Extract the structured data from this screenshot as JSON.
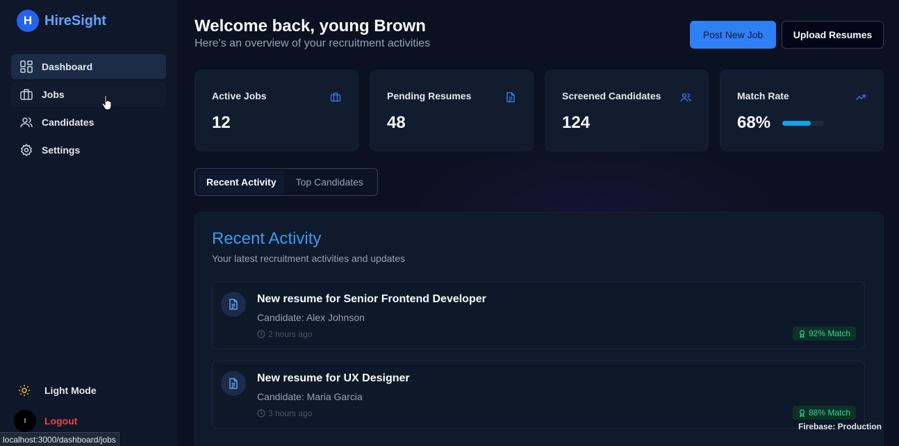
{
  "brand": {
    "logo_letter": "H",
    "name": "HireSight"
  },
  "sidebar": {
    "items": [
      {
        "label": "Dashboard",
        "icon": "dashboard-icon",
        "active": true
      },
      {
        "label": "Jobs",
        "icon": "briefcase-icon",
        "active": false
      },
      {
        "label": "Candidates",
        "icon": "users-icon",
        "active": false
      },
      {
        "label": "Settings",
        "icon": "gear-icon",
        "active": false
      }
    ],
    "light_mode_label": "Light Mode",
    "avatar_letter": "I",
    "logout_label": "Logout"
  },
  "status_bar_url": "localhost:3000/dashboard/jobs",
  "header": {
    "title": "Welcome back, young Brown",
    "subtitle": "Here's an overview of your recruitment activities",
    "post_job_label": "Post New Job",
    "upload_label": "Upload Resumes"
  },
  "stats": [
    {
      "title": "Active Jobs",
      "value": "12",
      "icon": "briefcase-icon"
    },
    {
      "title": "Pending Resumes",
      "value": "48",
      "icon": "document-icon"
    },
    {
      "title": "Screened Candidates",
      "value": "124",
      "icon": "users-icon"
    },
    {
      "title": "Match Rate",
      "value": "68%",
      "icon": "trending-up-icon",
      "progress": 0.68
    }
  ],
  "tabs": [
    {
      "label": "Recent Activity",
      "active": true
    },
    {
      "label": "Top Candidates",
      "active": false
    }
  ],
  "panel": {
    "title": "Recent Activity",
    "subtitle": "Your latest recruitment activities and updates",
    "activities": [
      {
        "title": "New resume for Senior Frontend Developer",
        "candidate": "Candidate: Alex Johnson",
        "time": "2 hours ago",
        "match": "92% Match"
      },
      {
        "title": "New resume for UX Designer",
        "candidate": "Candidate: Maria Garcia",
        "time": "3 hours ago",
        "match": "88% Match"
      }
    ]
  },
  "footer_label": "Firebase: Production",
  "colors": {
    "accent": "#3b82f6",
    "brand": "#60a5fa",
    "success": "#34d399",
    "danger": "#ef4444"
  }
}
